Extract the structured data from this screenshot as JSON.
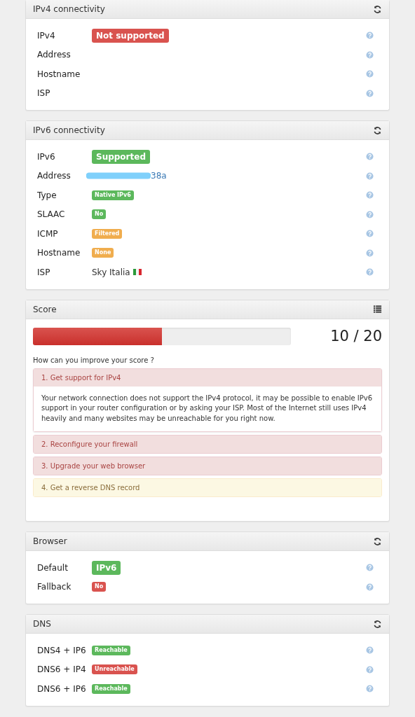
{
  "panels": [
    {
      "title": "IPv4 connectivity",
      "rows": [
        {
          "label": "IPv4",
          "kind": "badge-large",
          "value": "Not supported",
          "color": "#d9534f"
        },
        {
          "label": "Address",
          "kind": "empty"
        },
        {
          "label": "Hostname",
          "kind": "empty"
        },
        {
          "label": "ISP",
          "kind": "empty"
        }
      ]
    },
    {
      "title": "IPv6 connectivity",
      "rows": [
        {
          "label": "IPv6",
          "kind": "badge-large",
          "value": "Supported",
          "color": "#5cb85c"
        },
        {
          "label": "Address",
          "kind": "redacted-link",
          "value": "38a"
        },
        {
          "label": "Type",
          "kind": "badge",
          "value": "Native IPv6",
          "color": "#5cb85c"
        },
        {
          "label": "SLAAC",
          "kind": "badge",
          "value": "No",
          "color": "#5cb85c"
        },
        {
          "label": "ICMP",
          "kind": "badge",
          "value": "Filtered",
          "color": "#f0ad4e"
        },
        {
          "label": "Hostname",
          "kind": "badge",
          "value": "None",
          "color": "#f0ad4e"
        },
        {
          "label": "ISP",
          "kind": "flag-text",
          "value": "Sky Italia"
        }
      ]
    },
    {
      "title": "Score",
      "score": {
        "level": 0.5,
        "value": "10 / 20",
        "question": "How can you improve your score ?",
        "tips": [
          {
            "title": "1. Get support for IPv4",
            "kind": "danger",
            "expanded": true,
            "body": "Your network connection does not support the IPv4 protocol, it may be possible to enable IPv6 support in your router configuration or by asking your ISP. Most of the Internet still uses IPv4 heavily and many websites may be unreachable for you right now."
          },
          {
            "title": "2. Reconfigure your firewall",
            "kind": "danger",
            "expanded": false
          },
          {
            "title": "3. Upgrade your web browser",
            "kind": "danger",
            "expanded": false
          },
          {
            "title": "4. Get a reverse DNS record",
            "kind": "warning",
            "expanded": false
          }
        ]
      }
    },
    {
      "title": "Browser",
      "rows": [
        {
          "label": "Default",
          "kind": "badge-large",
          "value": "IPv6",
          "color": "#5cb85c"
        },
        {
          "label": "Fallback",
          "kind": "badge",
          "value": "No",
          "color": "#d9534f"
        }
      ]
    },
    {
      "title": "DNS",
      "rows": [
        {
          "label": "DNS4 + IP6",
          "kind": "badge",
          "value": "Reachable",
          "color": "#5cb85c"
        },
        {
          "label": "DNS6 + IP4",
          "kind": "badge",
          "value": "Unreachable",
          "color": "#d9534f"
        },
        {
          "label": "DNS6 + IP6",
          "kind": "badge",
          "value": "Reachable",
          "color": "#5cb85c"
        }
      ]
    }
  ]
}
